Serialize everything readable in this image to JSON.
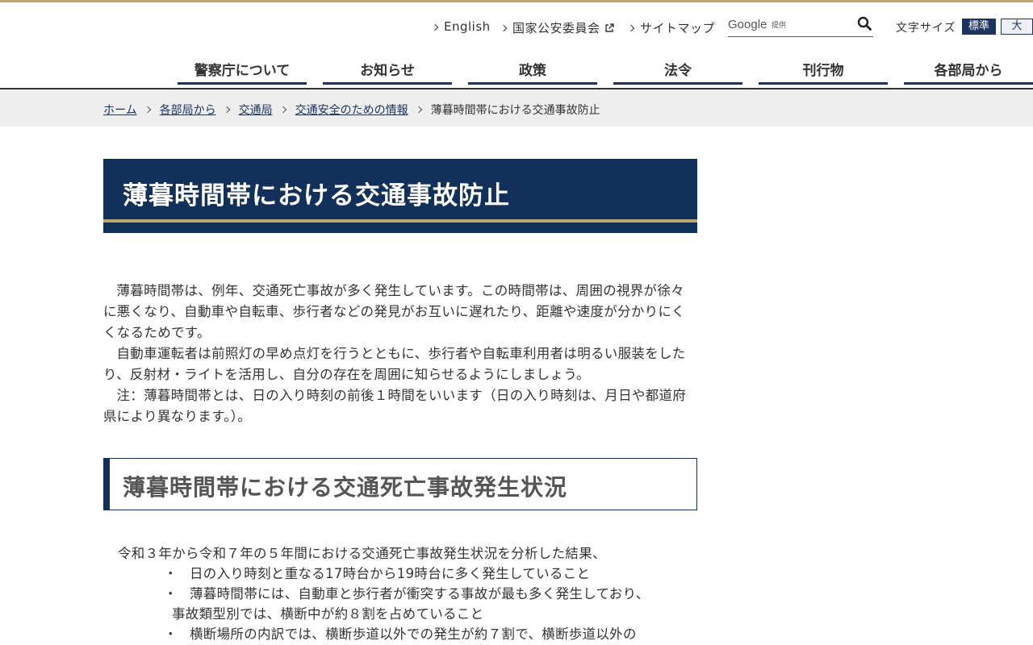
{
  "utility": {
    "english": "English",
    "psc": "国家公安委員会",
    "sitemap": "サイトマップ",
    "google": "Google",
    "google_sub": "提供",
    "fontsize_label": "文字サイズ",
    "fontsize_standard": "標準",
    "fontsize_large": "大"
  },
  "gnav": [
    "警察庁について",
    "お知らせ",
    "政策",
    "法令",
    "刊行物",
    "各部局から"
  ],
  "breadcrumb": {
    "items": [
      "ホーム",
      "各部局から",
      "交通局",
      "交通安全のための情報"
    ],
    "current": "薄暮時間帯における交通事故防止"
  },
  "title": "薄暮時間帯における交通事故防止",
  "intro_lines": [
    "薄暮時間帯は、例年、交通死亡事故が多く発生しています。この時間帯は、周囲の視界が徐々に悪くなり、自動車や自転車、歩行者などの発見がお互いに遅れたり、距離や速度が分かりにくくなるためです。",
    "自動車運転者は前照灯の早め点灯を行うとともに、歩行者や自転車利用者は明るい服装をしたり、反射材・ライトを活用し、自分の存在を周囲に知らせるようにしましょう。",
    "注：薄暮時間帯とは、日の入り時刻の前後１時間をいいます（日の入り時刻は、月日や都道府県により異なります。）。"
  ],
  "section_heading": "薄暮時間帯における交通死亡事故発生状況",
  "analysis": {
    "intro": "令和３年から令和７年の５年間における交通死亡事故発生状況を分析した結果、",
    "bullet_mark": "・",
    "b1": "日の入り時刻と重なる17時台から19時台に多く発生していること",
    "b2": "薄暮時間帯には、自動車と歩行者が衝突する事故が最も多く発生しており、",
    "b2_cont": "事故類型別では、横断中が約８割を占めていること",
    "b3": "横断場所の内訳では、横断歩道以外での発生が約７割で、横断歩道以外の"
  }
}
